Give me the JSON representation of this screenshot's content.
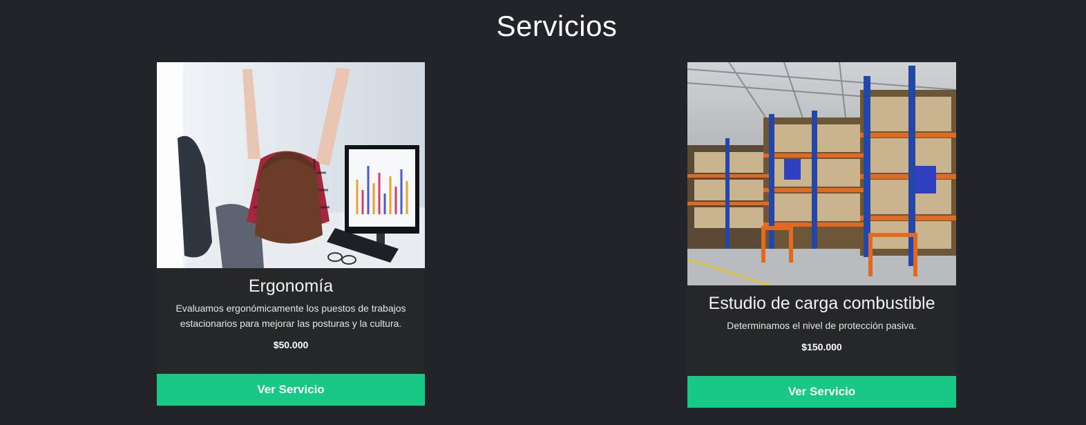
{
  "page": {
    "title": "Servicios"
  },
  "services": [
    {
      "title": "Ergonomía",
      "description": "Evaluamos ergonómicamente los puestos de trabajos estacionarios para mejorar las posturas y la cultura.",
      "price": "$50.000",
      "button_label": "Ver Servicio"
    },
    {
      "title": "Estudio de carga combustible",
      "description": "Determinamos el nivel de protección pasiva.",
      "price": "$150.000",
      "button_label": "Ver Servicio"
    }
  ],
  "colors": {
    "background": "#212428",
    "card": "#262728",
    "accent": "#17c985"
  }
}
